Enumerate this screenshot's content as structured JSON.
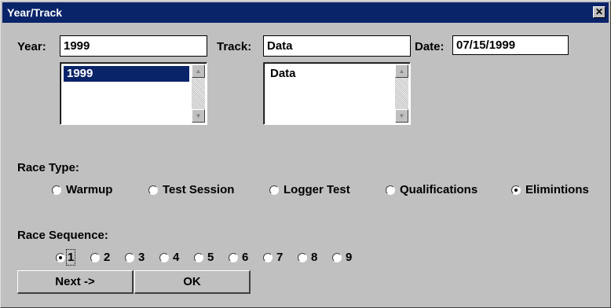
{
  "window": {
    "title": "Year/Track",
    "close_glyph": "✕"
  },
  "year": {
    "label": "Year:",
    "value": "1999",
    "list": [
      "1999"
    ]
  },
  "track": {
    "label": "Track:",
    "value": "Data",
    "list": [
      "Data"
    ]
  },
  "date": {
    "label": "Date:",
    "value": "07/15/1999"
  },
  "race_type": {
    "label": "Race Type:",
    "options": [
      "Warmup",
      "Test Session",
      "Logger Test",
      "Qualifications",
      "Elimintions"
    ],
    "selected": "Elimintions"
  },
  "race_sequence": {
    "label": "Race Sequence:",
    "options": [
      "1",
      "2",
      "3",
      "4",
      "5",
      "6",
      "7",
      "8",
      "9"
    ],
    "selected": "1"
  },
  "buttons": {
    "next": "Next ->",
    "ok": "OK"
  },
  "colors": {
    "titlebar": "#0a246a",
    "face": "#c0c0c0",
    "selection": "#0a246a"
  }
}
